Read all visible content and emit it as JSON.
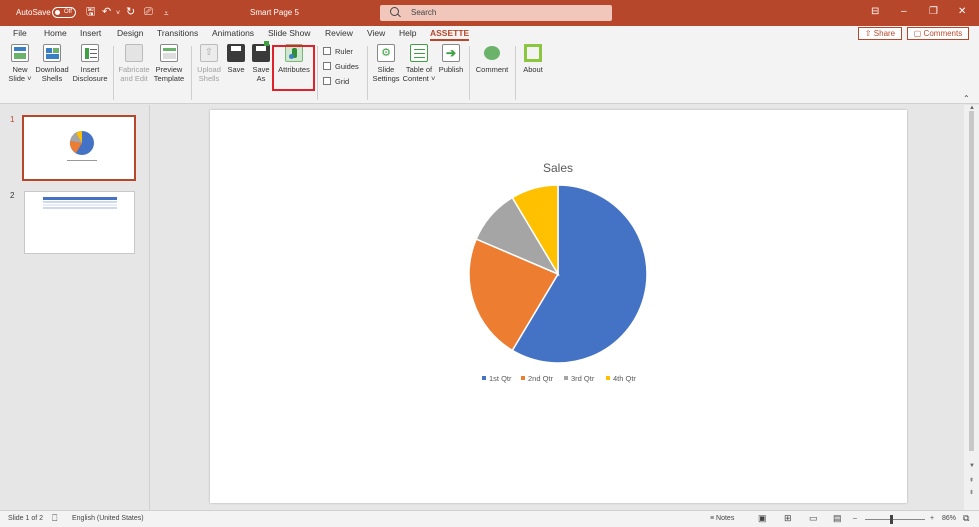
{
  "titlebar": {
    "autosave_label": "AutoSave",
    "autosave_state": "Off",
    "doc_title": "Smart Page 5",
    "search_placeholder": "Search",
    "accent": "#b7472a"
  },
  "tabs": [
    "File",
    "Home",
    "Insert",
    "Design",
    "Transitions",
    "Animations",
    "Slide Show",
    "Review",
    "View",
    "Help",
    "ASSETTE"
  ],
  "active_tab": "ASSETTE",
  "share_label": "Share",
  "comments_label": "Comments",
  "ribbon": {
    "new_slide": [
      "New",
      "Slide ˅"
    ],
    "download_shells": [
      "Download",
      "Shells"
    ],
    "insert_disclosure": [
      "Insert",
      "Disclosure"
    ],
    "fabricate_edit": [
      "Fabricate",
      "and Edit"
    ],
    "preview_template": [
      "Preview",
      "Template"
    ],
    "upload_shells": [
      "Upload",
      "Shells"
    ],
    "save": "Save",
    "save_as": [
      "Save",
      "As"
    ],
    "attributes": "Attributes",
    "ruler": "Ruler",
    "guides": "Guides",
    "grid": "Grid",
    "slide_settings": [
      "Slide",
      "Settings"
    ],
    "table_of_content": [
      "Table of",
      "Content ˅"
    ],
    "publish": "Publish",
    "comment": "Comment",
    "about": "About"
  },
  "thumbnails": [
    {
      "number": "1",
      "selected": true
    },
    {
      "number": "2",
      "selected": false
    }
  ],
  "chart_data": {
    "type": "pie",
    "title": "Sales",
    "categories": [
      "1st Qtr",
      "2nd Qtr",
      "3rd Qtr",
      "4th Qtr"
    ],
    "values": [
      8.2,
      3.2,
      1.4,
      1.2
    ],
    "colors": [
      "#4472c4",
      "#ed7d31",
      "#a5a5a5",
      "#ffc000"
    ],
    "legend": "bottom"
  },
  "status": {
    "slide_info": "Slide 1 of 2",
    "language": "English (United States)",
    "notes": "Notes",
    "zoom": "86%"
  }
}
